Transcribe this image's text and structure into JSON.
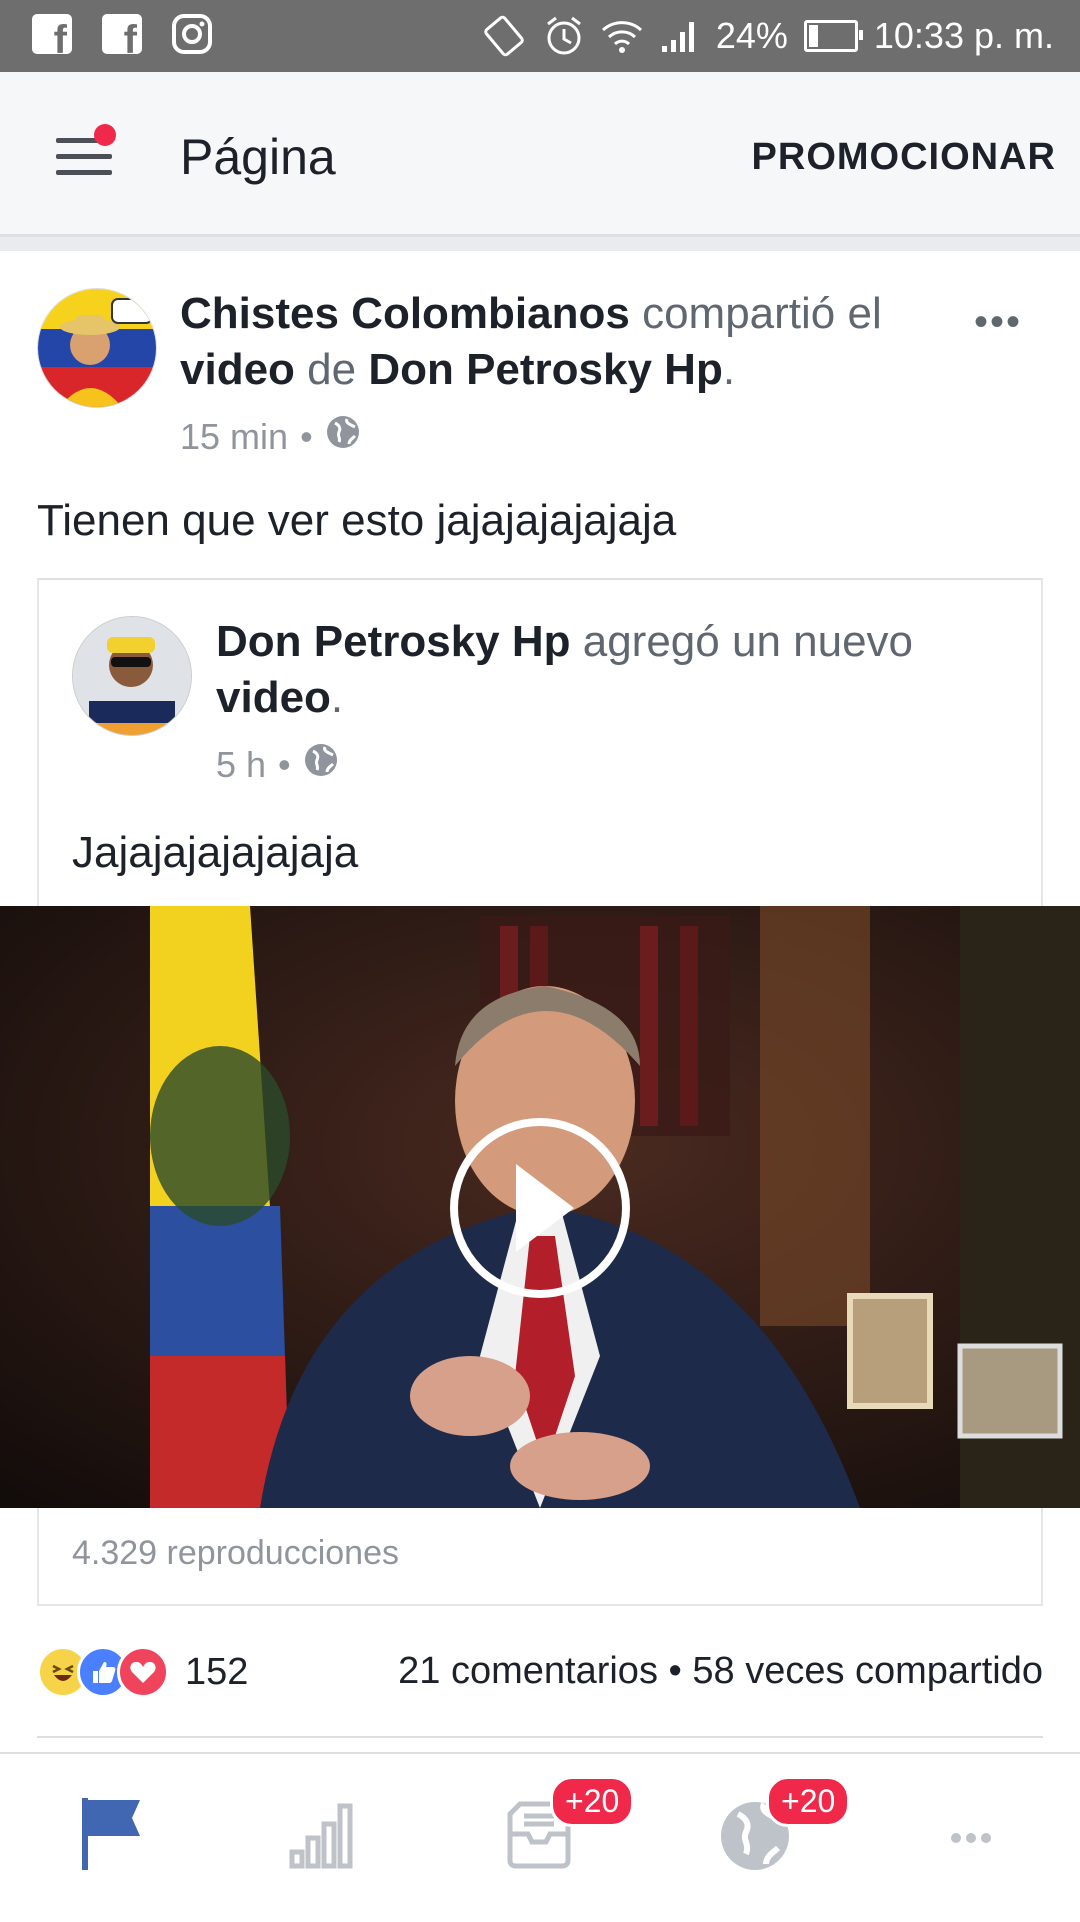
{
  "status_bar": {
    "battery": "24%",
    "time": "10:33 p. m."
  },
  "app_bar": {
    "title": "Página",
    "promote_label": "PROMOCIONAR"
  },
  "post": {
    "author": "Chistes Colombianos",
    "action_1": " compartió el ",
    "object": "video",
    "action_2": " de ",
    "source": "Don Petrosky Hp",
    "punct": ".",
    "time": "15 min",
    "text": "Tienen que ver esto jajajajajajaja",
    "more_label": "•••",
    "shared": {
      "author": "Don Petrosky Hp",
      "action": " agregó un nuevo ",
      "object": "video",
      "punct": ".",
      "time": "5 h",
      "text": "Jajajajajajajaja",
      "views": "4.329 reproducciones"
    },
    "reaction_count": "152",
    "stats": "21 comentarios • 58 veces compartido"
  },
  "bottom_nav": {
    "items": [
      {
        "icon": "flag-icon",
        "active": true
      },
      {
        "icon": "insights-icon"
      },
      {
        "icon": "inbox-icon",
        "badge": "+20"
      },
      {
        "icon": "globe-icon",
        "badge": "+20"
      },
      {
        "icon": "more-icon"
      }
    ]
  },
  "colors": {
    "accent": "#4267b2",
    "badge": "#f02849",
    "status_bar": "#6e6e6e"
  }
}
